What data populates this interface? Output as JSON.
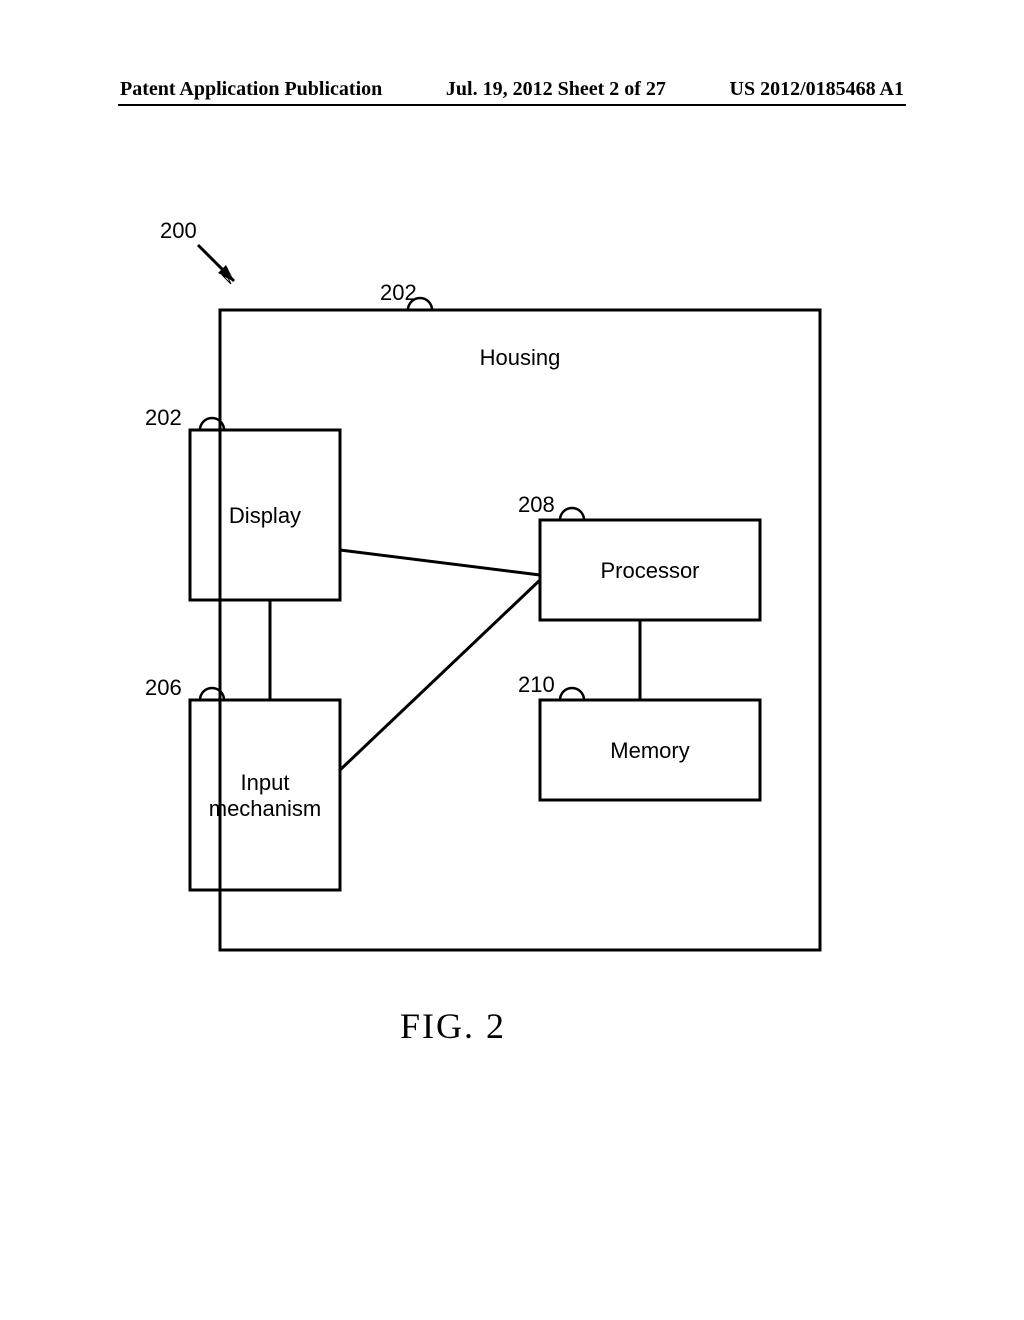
{
  "header": {
    "left": "Patent Application Publication",
    "center": "Jul. 19, 2012  Sheet 2 of 27",
    "right": "US 2012/0185468 A1"
  },
  "figure_label": "FIG.  2",
  "refs": {
    "r200": "200",
    "r202a": "202",
    "r202b": "202",
    "r206": "206",
    "r208": "208",
    "r210": "210"
  },
  "blocks": {
    "housing": "Housing",
    "display": "Display",
    "processor": "Processor",
    "memory": "Memory",
    "input": "Input\nmechanism"
  }
}
